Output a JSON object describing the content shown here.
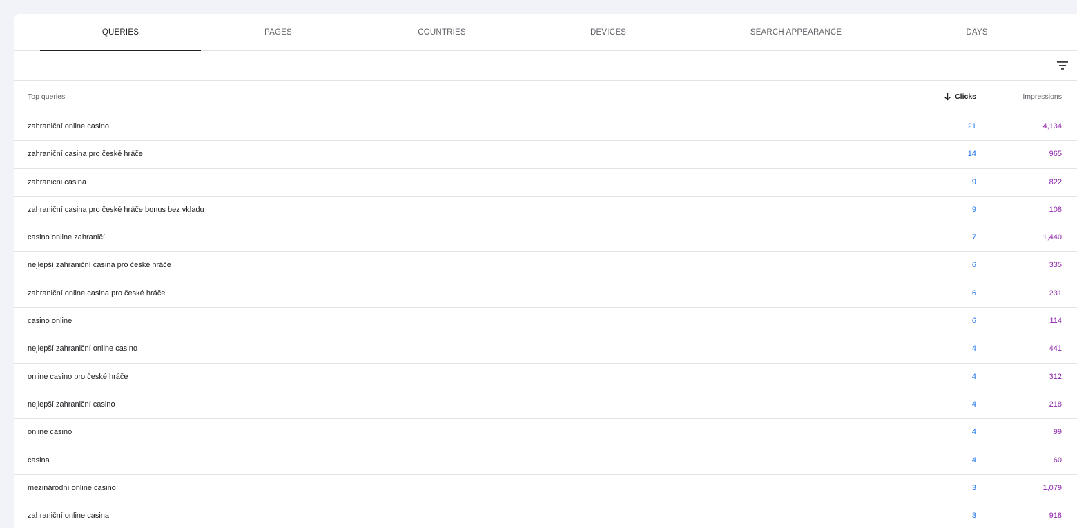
{
  "tabs": [
    {
      "label": "QUERIES",
      "active": true
    },
    {
      "label": "PAGES",
      "active": false
    },
    {
      "label": "COUNTRIES",
      "active": false
    },
    {
      "label": "DEVICES",
      "active": false
    },
    {
      "label": "SEARCH APPEARANCE",
      "active": false
    },
    {
      "label": "DAYS",
      "active": false
    }
  ],
  "toolbar": {
    "filter_icon": "filter-list-icon"
  },
  "table": {
    "headers": {
      "query": "Top queries",
      "clicks": "Clicks",
      "impressions": "Impressions",
      "sort_icon": "arrow-down-icon"
    },
    "rows": [
      {
        "query": "zahraniční online casino",
        "clicks": "21",
        "impressions": "4,134"
      },
      {
        "query": "zahraniční casina pro české hráče",
        "clicks": "14",
        "impressions": "965"
      },
      {
        "query": "zahranicni casina",
        "clicks": "9",
        "impressions": "822"
      },
      {
        "query": "zahraniční casina pro české hráče bonus bez vkladu",
        "clicks": "9",
        "impressions": "108"
      },
      {
        "query": "casino online zahraničí",
        "clicks": "7",
        "impressions": "1,440"
      },
      {
        "query": "nejlepší zahraniční casina pro české hráče",
        "clicks": "6",
        "impressions": "335"
      },
      {
        "query": "zahraniční online casina pro české hráče",
        "clicks": "6",
        "impressions": "231"
      },
      {
        "query": "casino online",
        "clicks": "6",
        "impressions": "114"
      },
      {
        "query": "nejlepší zahraniční online casino",
        "clicks": "4",
        "impressions": "441"
      },
      {
        "query": "online casino pro české hráče",
        "clicks": "4",
        "impressions": "312"
      },
      {
        "query": "nejlepší zahraniční casino",
        "clicks": "4",
        "impressions": "218"
      },
      {
        "query": "online casino",
        "clicks": "4",
        "impressions": "99"
      },
      {
        "query": "casina",
        "clicks": "4",
        "impressions": "60"
      },
      {
        "query": "mezinárodní online casino",
        "clicks": "3",
        "impressions": "1,079"
      },
      {
        "query": "zahraniční online casina",
        "clicks": "3",
        "impressions": "918"
      }
    ]
  },
  "colors": {
    "clicks": "#1a73e8",
    "impressions": "#8e24aa",
    "background": "#f1f3f8"
  }
}
